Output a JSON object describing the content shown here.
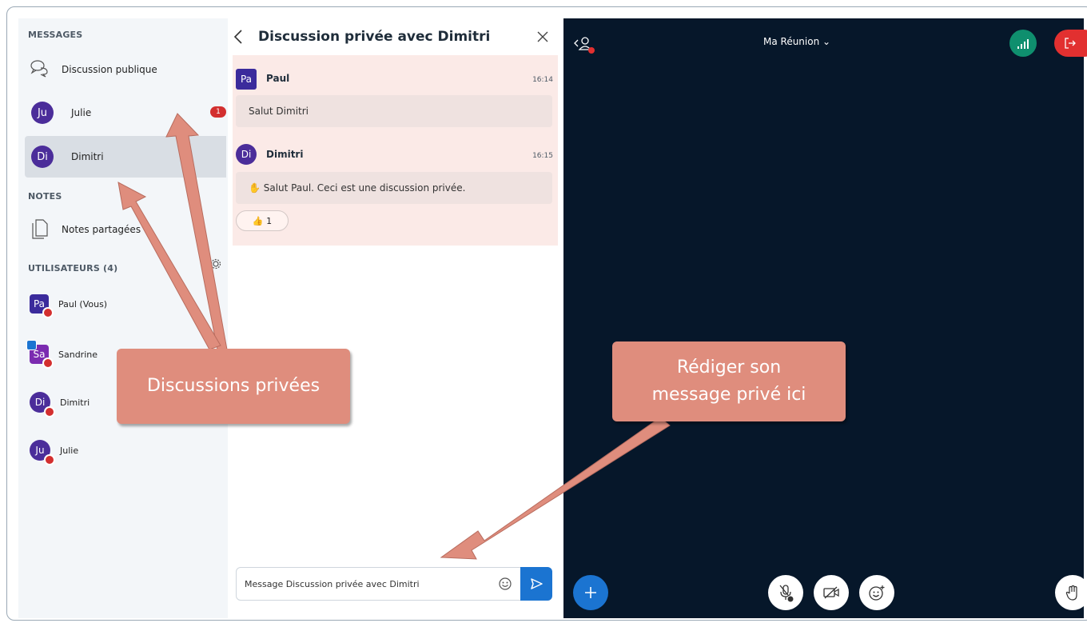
{
  "sidebar": {
    "messages_title": "MESSAGES",
    "public_chat_label": "Discussion publique",
    "chats": [
      {
        "initials": "Ju",
        "name": "Julie",
        "unread": "1",
        "color": "#4b2d9a"
      },
      {
        "initials": "Di",
        "name": "Dimitri",
        "unread": "",
        "color": "#4b2d9a"
      }
    ],
    "notes_title": "NOTES",
    "shared_notes_label": "Notes partagées",
    "users_title": "UTILISATEURS (4)",
    "users": [
      {
        "initials": "Pa",
        "name": "Paul (Vous)",
        "color": "#3b2b9c"
      },
      {
        "initials": "Sa",
        "name": "Sandrine",
        "color": "#7b2bb0"
      },
      {
        "initials": "Di",
        "name": "Dimitri",
        "color": "#4b2d9a"
      },
      {
        "initials": "Ju",
        "name": "Julie",
        "color": "#4b2d9a"
      }
    ]
  },
  "chat": {
    "title": "Discussion privée avec Dimitri",
    "messages": [
      {
        "initials": "Pa",
        "author": "Paul",
        "time": "16:14",
        "text": "Salut Dimitri",
        "color": "#3b2b9c"
      },
      {
        "initials": "Di",
        "author": "Dimitri",
        "time": "16:15",
        "text": "✋ Salut Paul. Ceci est une discussion privée.",
        "color": "#4b2d9a"
      }
    ],
    "reaction": "👍 1",
    "input_placeholder": "Message Discussion privée avec Dimitri"
  },
  "main": {
    "meeting_title": "Ma Réunion ⌄"
  },
  "annotations": {
    "private_chats": "Discussions privées",
    "write_message_line1": "Rédiger son",
    "write_message_line2": "message privé ici"
  },
  "colors": {
    "accent_blue": "#1b74d1",
    "leave_red": "#e23030",
    "connection_green": "#0f8f6e",
    "video_bg": "#06172a",
    "annotation": "#df8d7d"
  }
}
